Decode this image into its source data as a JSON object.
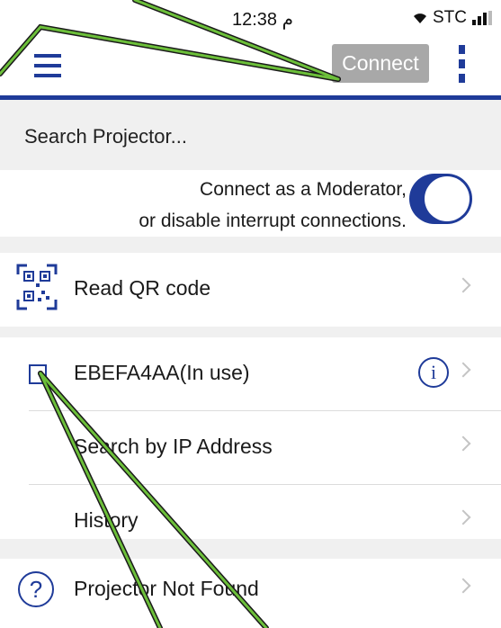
{
  "status_bar": {
    "time": "12:38 م",
    "carrier": "STC"
  },
  "navbar": {
    "menu_icon": "hamburger-icon",
    "connect_label": "Connect",
    "more_icon": "more-vertical-icon"
  },
  "search": {
    "placeholder": "Search Projector..."
  },
  "moderator": {
    "line1": "Connect as a Moderator,",
    "line2": "or disable interrupt connections.",
    "toggle_on": true
  },
  "rows": {
    "qr": {
      "label": "Read QR code",
      "icon": "qr-code-icon"
    },
    "projector": {
      "label": "EBEFA4AA(In use)",
      "icon": "checkbox-icon",
      "info_icon": "info-icon"
    },
    "ip": {
      "label": "Search by IP Address"
    },
    "history": {
      "label": "History"
    },
    "not_found": {
      "label": "Projector Not Found",
      "icon": "help-icon"
    }
  },
  "colors": {
    "accent": "#1f3b99",
    "annotation": "#6cbf3a",
    "button_disabled": "#a8a8a8"
  }
}
